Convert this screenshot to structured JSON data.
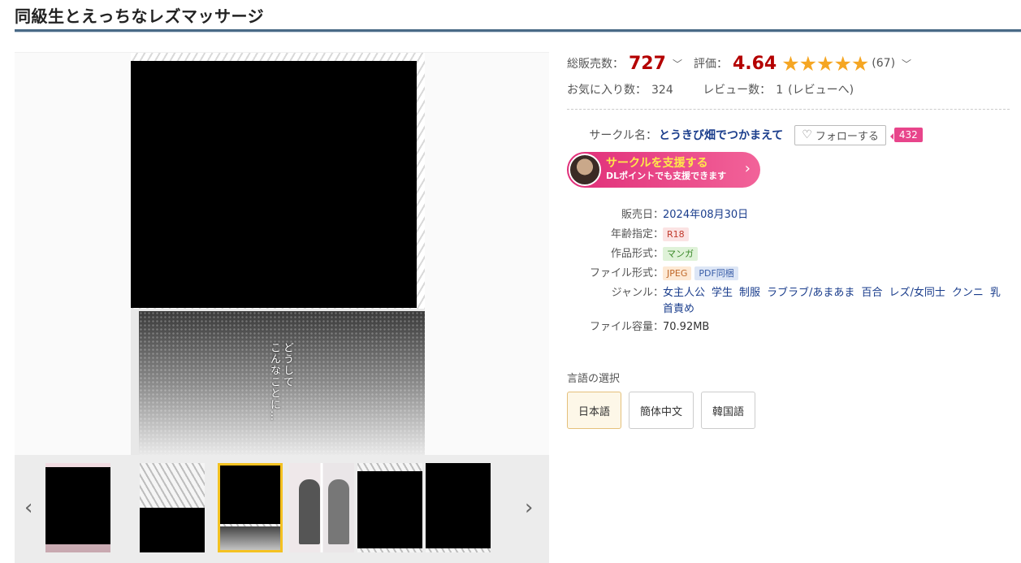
{
  "title": "同級生とえっちなレズマッサージ",
  "gallery": {
    "vertical_text": "どうして\nこんなことに…",
    "prev_icon": "chevron-left-icon",
    "next_icon": "chevron-right-icon"
  },
  "sales": {
    "sales_label": "総販売数：",
    "sales_count": "727",
    "rating_label": "評価：",
    "rating_value": "4.64",
    "stars": "★★★★★",
    "rating_count": "(67)",
    "favorites_label": "お気に入り数：",
    "favorites_count": "324",
    "reviews_label": "レビュー数：",
    "reviews_count": "1",
    "reviews_link": "(レビューへ)"
  },
  "circle": {
    "label": "サークル名：",
    "name": "とうきび畑でつかまえて",
    "follow_label": "フォローする",
    "follower_count": "432",
    "support_main": "サークルを支援する",
    "support_sub": "DLポイントでも支援できます"
  },
  "details": {
    "release_label": "販売日",
    "release_value": "2024年08月30日",
    "age_label": "年齢指定",
    "age_value": "R18",
    "format_label": "作品形式",
    "format_value": "マンガ",
    "filetype_label": "ファイル形式",
    "filetype_values": [
      "JPEG",
      "PDF同梱"
    ],
    "genre_label": "ジャンル",
    "genres": [
      "女主人公",
      "学生",
      "制服",
      "ラブラブ/あまあま",
      "百合",
      "レズ/女同士",
      "クンニ",
      "乳首責め"
    ],
    "size_label": "ファイル容量",
    "size_value": "70.92MB"
  },
  "language": {
    "title": "言語の選択",
    "options": [
      "日本語",
      "簡体中文",
      "韓国語"
    ],
    "selected": "日本語"
  }
}
